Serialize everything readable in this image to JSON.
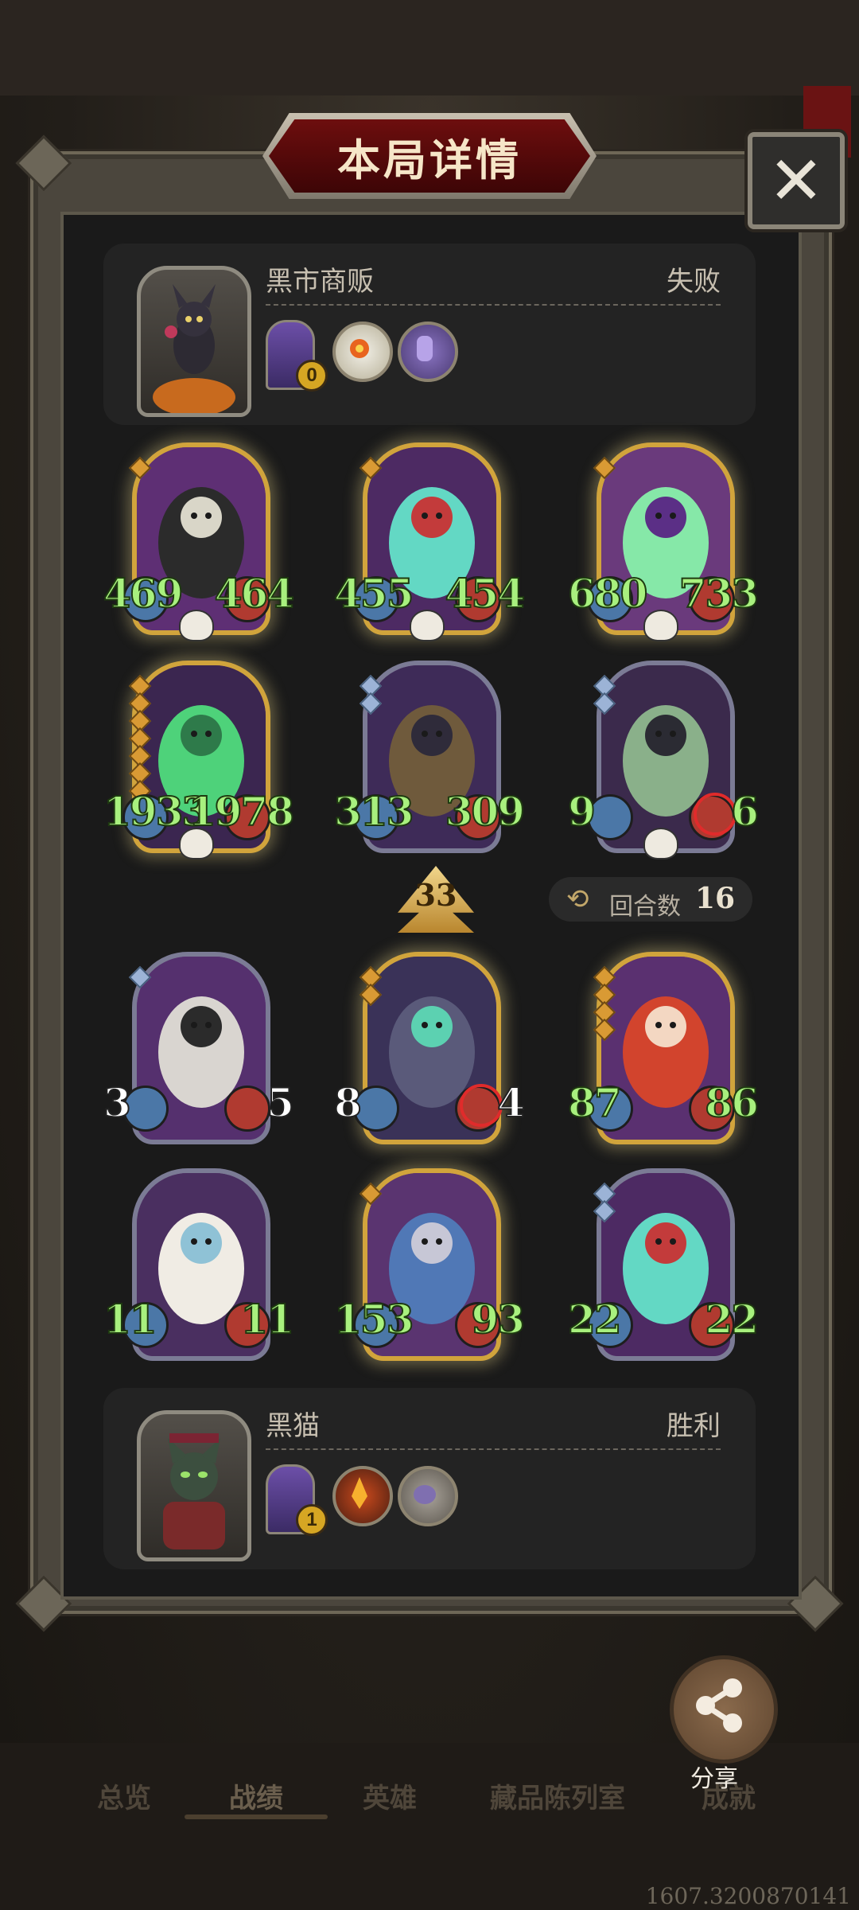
{
  "header": {
    "title": "本局详情",
    "close_label": "✕"
  },
  "opponent": {
    "name": "黑市商贩",
    "result": "失败",
    "door_count": "0",
    "trinkets": [
      "sun-flower-coin",
      "purple-door-coin"
    ]
  },
  "player": {
    "name": "黑猫",
    "result": "胜利",
    "door_count": "1",
    "trinkets": [
      "fire-torch-coin",
      "dragon-coin"
    ]
  },
  "opponent_board": [
    {
      "atk": "469",
      "hp": "464",
      "frame": "gold",
      "gems": 1,
      "skull": true,
      "art": "skeleton-witch"
    },
    {
      "atk": "455",
      "hp": "454",
      "frame": "gold",
      "gems": 1,
      "skull": true,
      "art": "ghost-genie"
    },
    {
      "atk": "680",
      "hp": "733",
      "frame": "gold",
      "gems": 1,
      "skull": true,
      "art": "green-ghost-cat"
    },
    {
      "atk": "1933",
      "hp": "1978",
      "frame": "gold",
      "gems": 7,
      "skull": true,
      "art": "green-vampire"
    },
    {
      "atk": "313",
      "hp": "309",
      "frame": "silver",
      "gems": 2,
      "skull": false,
      "art": "bard"
    },
    {
      "atk": "9",
      "hp": "6",
      "frame": "silver",
      "gems": 2,
      "skull": true,
      "art": "witch",
      "hp_target": true
    }
  ],
  "player_board": [
    {
      "atk": "3",
      "hp": "5",
      "frame": "silver",
      "gems": 1,
      "skull": false,
      "art": "horned-serpent",
      "white": true
    },
    {
      "atk": "8",
      "hp": "4",
      "frame": "gold",
      "gems": 2,
      "skull": false,
      "art": "shadow-dragon",
      "white": true,
      "hp_target": true
    },
    {
      "atk": "87",
      "hp": "86",
      "frame": "gold",
      "gems": 4,
      "skull": false,
      "art": "red-hair-elf"
    },
    {
      "atk": "11",
      "hp": "11",
      "frame": "silver",
      "gems": 0,
      "skull": false,
      "art": "white-dragon"
    },
    {
      "atk": "153",
      "hp": "93",
      "frame": "gold",
      "gems": 1,
      "skull": false,
      "art": "blue-dragon"
    },
    {
      "atk": "22",
      "hp": "22",
      "frame": "silver",
      "gems": 2,
      "skull": false,
      "art": "ghost-genie"
    }
  ],
  "round": {
    "level": "33",
    "label": "回合数",
    "value": "16"
  },
  "nav": {
    "items": [
      "总览",
      "战绩",
      "英雄",
      "藏品陈列室",
      "成就"
    ],
    "active": "战绩"
  },
  "share": {
    "label": "分享"
  },
  "version": "1607.3200870141"
}
